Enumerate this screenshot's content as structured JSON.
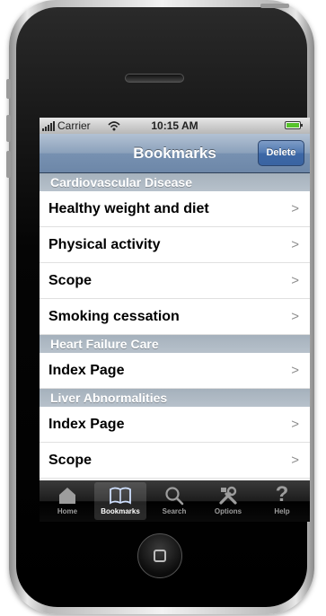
{
  "status_bar": {
    "carrier": "Carrier",
    "time": "10:15 AM"
  },
  "nav_bar": {
    "title": "Bookmarks",
    "delete_label": "Delete"
  },
  "sections": [
    {
      "header": "Cardiovascular Disease",
      "items": [
        "Healthy weight and diet",
        "Physical activity",
        "Scope",
        "Smoking cessation"
      ]
    },
    {
      "header": "Heart Failure Care",
      "items": [
        "Index Page"
      ]
    },
    {
      "header": "Liver Abnormalities",
      "items": [
        "Index Page",
        "Scope"
      ]
    }
  ],
  "chevron": ">",
  "tab_bar": {
    "tabs": [
      {
        "label": "Home",
        "icon": "home-icon"
      },
      {
        "label": "Bookmarks",
        "icon": "book-icon",
        "selected": true
      },
      {
        "label": "Search",
        "icon": "search-icon"
      },
      {
        "label": "Options",
        "icon": "tools-icon"
      },
      {
        "label": "Help",
        "icon": "question-icon"
      }
    ]
  },
  "colors": {
    "nav_bar": "#6d87a8",
    "delete_button": "#3d68a6",
    "section_header": "#b3bec9",
    "battery": "#57c32b",
    "tab_bar": "#000000"
  }
}
